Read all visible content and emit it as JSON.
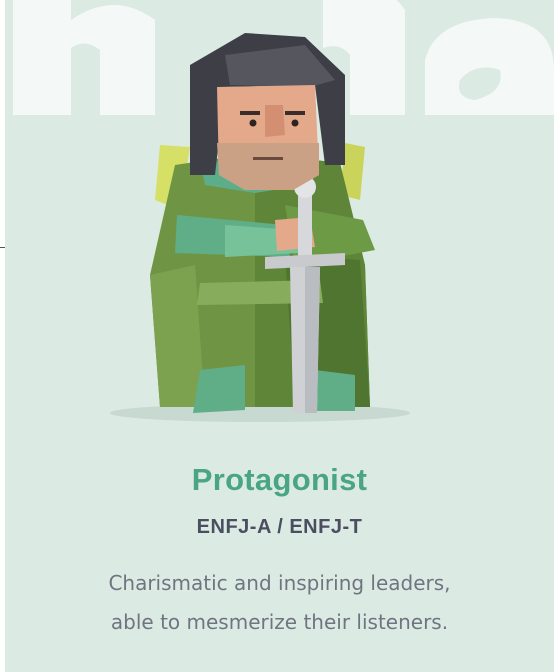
{
  "card": {
    "title": "Protagonist",
    "type_code": "ENFJ-A / ENFJ-T",
    "description_lines": [
      "Charismatic and inspiring leaders,",
      "able to mesmerize their listeners."
    ]
  },
  "colors": {
    "card_background": "#dceae4",
    "title": "#4aa582",
    "type_code": "#4a4e5e",
    "description": "#6f7480"
  },
  "icons": {
    "illustration": "protagonist-character-illustration",
    "watermark": "background-letters-watermark"
  }
}
